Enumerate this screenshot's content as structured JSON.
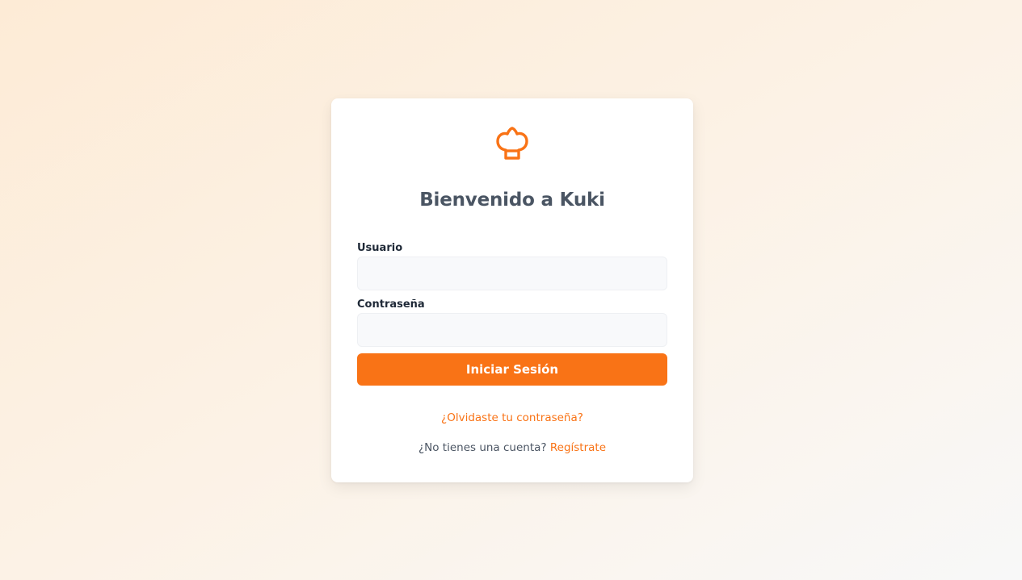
{
  "brand": {
    "icon": "chef-hat-icon",
    "accent_color": "#f97316"
  },
  "login": {
    "title": "Bienvenido a Kuki",
    "username_label": "Usuario",
    "username_value": "",
    "password_label": "Contraseña",
    "password_value": "",
    "submit_label": "Iniciar Sesión",
    "forgot_link": "¿Olvidaste tu contraseña?",
    "signup_prompt": "¿No tienes una cuenta?",
    "signup_link": "Regístrate"
  }
}
